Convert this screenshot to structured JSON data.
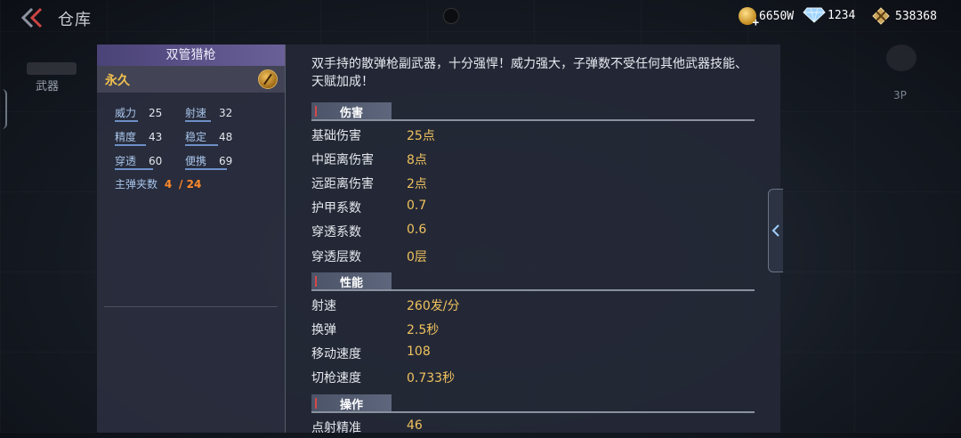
{
  "header": {
    "title": "仓库",
    "currencies": [
      {
        "icon": "gold-coin-plus-icon",
        "value": "6650W"
      },
      {
        "icon": "diamond-icon",
        "value": "1234"
      },
      {
        "icon": "medal-icon",
        "value": "538368"
      }
    ]
  },
  "side_nav": {
    "weapon_label": "武器",
    "view_label": "3P"
  },
  "weapon": {
    "name": "双管猎枪",
    "duration": "永久",
    "stats": [
      {
        "label": "威力",
        "value": "25",
        "level": 0.25
      },
      {
        "label": "射速",
        "value": "32",
        "level": 0.32
      },
      {
        "label": "精度",
        "value": "43",
        "level": 0.43
      },
      {
        "label": "稳定",
        "value": "48",
        "level": 0.48
      },
      {
        "label": "穿透",
        "value": "60",
        "level": 0.6
      },
      {
        "label": "便携",
        "value": "69",
        "level": 0.69
      }
    ],
    "magazine_label": "主弹夹数",
    "magazine_current": "4",
    "magazine_total": "/ 24"
  },
  "detail": {
    "description": "双手持的散弹枪副武器，十分强悍！威力强大，子弹数不受任何其他武器技能、天赋加成！",
    "sections": [
      {
        "title": "伤害",
        "rows": [
          {
            "k": "基础伤害",
            "v": "25点"
          },
          {
            "k": "中距离伤害",
            "v": "8点"
          },
          {
            "k": "远距离伤害",
            "v": "2点"
          },
          {
            "k": "护甲系数",
            "v": "0.7"
          },
          {
            "k": "穿透系数",
            "v": "0.6"
          },
          {
            "k": "穿透层数",
            "v": "0层"
          }
        ]
      },
      {
        "title": "性能",
        "rows": [
          {
            "k": "射速",
            "v": "260发/分"
          },
          {
            "k": "换弹",
            "v": "2.5秒"
          },
          {
            "k": "移动速度",
            "v": "108"
          },
          {
            "k": "切枪速度",
            "v": "0.733秒"
          }
        ]
      },
      {
        "title": "操作",
        "rows": [
          {
            "k": "点射精准",
            "v": "46"
          }
        ]
      }
    ]
  },
  "colors": {
    "accent_gold": "#f0c25e",
    "magazine_orange": "#ff8a2b",
    "title_bar": "#5a5288"
  }
}
